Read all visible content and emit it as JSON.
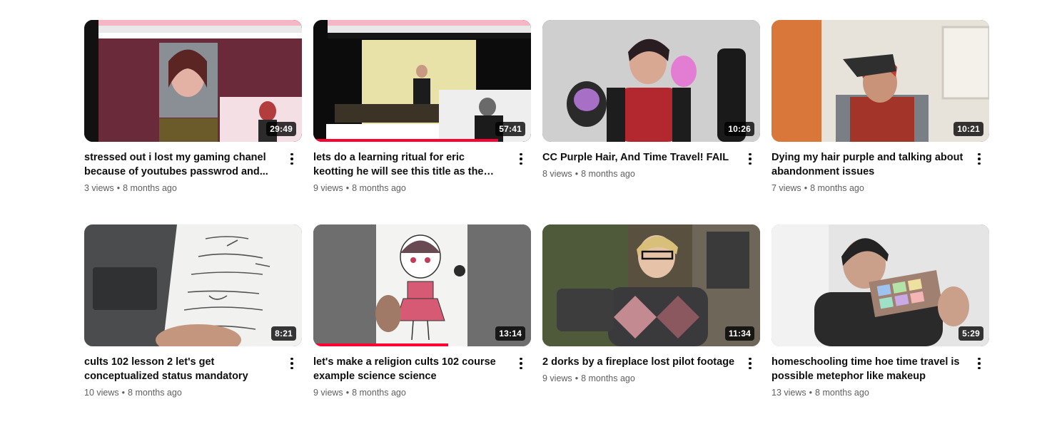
{
  "videos": [
    {
      "title": "stressed out i lost my gaming chanel because of youtubes passwrod and...",
      "views": "3 views",
      "age": "8 months ago",
      "duration": "29:49",
      "progress": 0
    },
    {
      "title": "lets do a learning ritual for eric keotting he will see this title as the most offensive self...",
      "views": "9 views",
      "age": "8 months ago",
      "duration": "57:41",
      "progress": 0.85
    },
    {
      "title": "CC Purple Hair, And Time Travel! FAIL",
      "views": "8 views",
      "age": "8 months ago",
      "duration": "10:26",
      "progress": 0
    },
    {
      "title": "Dying my hair purple and talking about abandonment issues",
      "views": "7 views",
      "age": "8 months ago",
      "duration": "10:21",
      "progress": 0
    },
    {
      "title": "cults 102 lesson 2 let's get conceptualized status mandatory",
      "views": "10 views",
      "age": "8 months ago",
      "duration": "8:21",
      "progress": 0
    },
    {
      "title": "let's make a religion cults 102 course example science science",
      "views": "9 views",
      "age": "8 months ago",
      "duration": "13:14",
      "progress": 0.62
    },
    {
      "title": "2 dorks by a fireplace lost pilot footage",
      "views": "9 views",
      "age": "8 months ago",
      "duration": "11:34",
      "progress": 0
    },
    {
      "title": "homeschooling time hoe time travel is possible metephor like makeup",
      "views": "13 views",
      "age": "8 months ago",
      "duration": "5:29",
      "progress": 0
    }
  ],
  "separator": "•",
  "colors": {
    "progress": "#ff0033",
    "meta": "#606060"
  }
}
